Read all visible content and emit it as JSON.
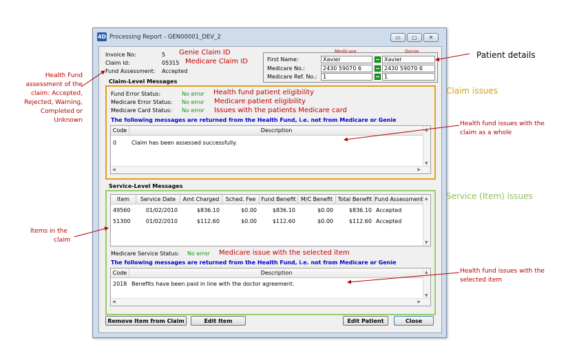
{
  "window": {
    "title": "Processing Report - GEN00001_DEV_2",
    "minimize": "▭",
    "maximize": "▢",
    "close": "✕",
    "app_icon": "4D"
  },
  "invoice": {
    "invoice_no_label": "Invoice No:",
    "invoice_no": "5",
    "claim_id_label": "Claim Id:",
    "claim_id": "05315",
    "fund_assessment_label": "Fund Assessment:",
    "fund_assessment": "Accepted"
  },
  "patient": {
    "medicare_header": "Medicare",
    "genie_header": "Genie",
    "first_name_label": "First Name:",
    "first_name_medicare": "Xavier",
    "first_name_genie": "Xavier",
    "medicare_no_label": "Medicare No.:",
    "medicare_no_medicare": "2430 59070 6",
    "medicare_no_genie": "2430 59070 6",
    "ref_no_label": "Medicare Ref. No.:",
    "ref_no_medicare": "1",
    "ref_no_genie": "1"
  },
  "claim_level": {
    "heading": "Claim-Level Messages",
    "fund_error_label": "Fund Error Status:",
    "fund_error_value": "No error",
    "medicare_error_label": "Medicare Error Status:",
    "medicare_error_value": "No error",
    "medicare_card_label": "Medicare Card Status:",
    "medicare_card_value": "No error",
    "notice": "The following messages are returned from the Health Fund, i.e. not from Medicare or Genie",
    "columns": [
      "Code",
      "Description"
    ],
    "rows": [
      {
        "code": "0",
        "description": "Claim has been assessed successfully."
      }
    ]
  },
  "service_level": {
    "heading": "Service-Level Messages",
    "columns": [
      "Item",
      "Service Date",
      "Amt Charged",
      "Sched. Fee",
      "Fund Benefit",
      "M/C Benefit",
      "Total Benefit",
      "Fund Assessment"
    ],
    "rows": [
      [
        "49560",
        "01/02/2010",
        "$836.10",
        "$0.00",
        "$836.10",
        "$0.00",
        "$836.10",
        "Accepted"
      ],
      [
        "51300",
        "01/02/2010",
        "$112.60",
        "$0.00",
        "$112.60",
        "$0.00",
        "$112.60",
        "Accepted"
      ]
    ],
    "medicare_service_label": "Medicare Service Status:",
    "medicare_service_value": "No error",
    "notice": "The following messages are returned from the Health Fund, i.e. not from Medicare or Genie",
    "msg_columns": [
      "Code",
      "Description"
    ],
    "msg_rows": [
      {
        "code": "2018",
        "description": "Benefits have been paid in line with the doctor agreement."
      }
    ]
  },
  "buttons": {
    "remove_item": "Remove Item from Claim",
    "edit_item": "Edit Item",
    "edit_patient": "Edit Patient",
    "close": "Close"
  },
  "annotations": {
    "genie_claim_id": "Genie Claim ID",
    "medicare_claim_id": "Medicare Claim ID",
    "patient_details": "Patient details",
    "hf_patient_eligibility": "Health fund patient eligibility",
    "mc_patient_eligibility": "Medicare patient eligibility",
    "card_issues": "Issues with the patients Medicare card",
    "claim_issues": "Claim issues",
    "hf_claim_issues_line1": "Health fund issues with the",
    "hf_claim_issues_line2": "claim as a whole",
    "service_issues": "Service (Item) issues",
    "mc_selected_item": "Medicare issue with the selected item",
    "hf_item_issues_line1": "Health fund issues with the",
    "hf_item_issues_line2": "selected item",
    "items_line1": "Items in the",
    "items_line2": "claim",
    "assessment_lines": [
      "Health Fund",
      "assessment of the",
      "claim: Accepted,",
      "Rejected, Warning,",
      "Completed or",
      "Unknown"
    ]
  },
  "colors": {
    "claim_box": "#e0a020",
    "service_box": "#99cc66",
    "annotation_red": "#b40000",
    "notice_blue": "#0000cc",
    "status_green": "#139413"
  }
}
